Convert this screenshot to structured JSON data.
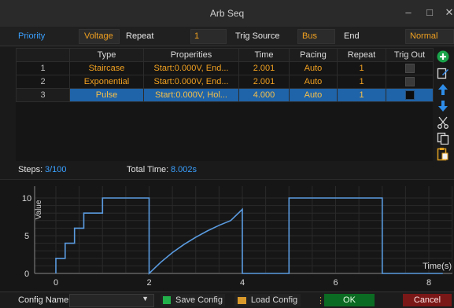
{
  "window": {
    "title": "Arb Seq"
  },
  "topbar": {
    "priority_label": "Priority",
    "priority_value": "Voltage",
    "repeat_label": "Repeat",
    "repeat_value": "1",
    "trig_source_label": "Trig Source",
    "trig_source_value": "Bus",
    "end_label": "End",
    "end_value": "Normal"
  },
  "table": {
    "columns": [
      "Type",
      "Properities",
      "Time",
      "Pacing",
      "Repeat",
      "Trig Out"
    ],
    "rows": [
      {
        "index": "1",
        "type": "Staircase",
        "properties": "Start:0.000V, End...",
        "time": "2.001",
        "pacing": "Auto",
        "repeat": "1",
        "trig_out": false,
        "selected": false
      },
      {
        "index": "2",
        "type": "Exponential",
        "properties": "Start:0.000V, End...",
        "time": "2.001",
        "pacing": "Auto",
        "repeat": "1",
        "trig_out": false,
        "selected": false
      },
      {
        "index": "3",
        "type": "Pulse",
        "properties": "Start:0.000V, Hol...",
        "time": "4.000",
        "pacing": "Auto",
        "repeat": "1",
        "trig_out": false,
        "selected": true
      }
    ]
  },
  "side_tools": [
    "add-icon",
    "edit-icon",
    "move-up-icon",
    "move-down-icon",
    "cut-icon",
    "copy-icon",
    "paste-icon"
  ],
  "info": {
    "steps_label": "Steps:",
    "steps_value": "3/100",
    "total_time_label": "Total Time:",
    "total_time_value": "8.002s"
  },
  "chart_data": {
    "type": "line",
    "ylabel": "Value",
    "xlabel": "Time(s)",
    "ylim": [
      0,
      10
    ],
    "xlim": [
      -1,
      8.3
    ],
    "yticks": [
      0,
      5,
      10
    ],
    "xticks": [
      0,
      2,
      4,
      6,
      8
    ],
    "grid": true,
    "color": "#5a9be0",
    "series": [
      {
        "points": [
          [
            0,
            0
          ],
          [
            0,
            2
          ],
          [
            0.2,
            2
          ],
          [
            0.2,
            4
          ],
          [
            0.4,
            4
          ],
          [
            0.4,
            6
          ],
          [
            0.6,
            6
          ],
          [
            0.6,
            8
          ],
          [
            1,
            8
          ],
          [
            1,
            10
          ],
          [
            2,
            10
          ],
          [
            2,
            0
          ],
          [
            2.25,
            1.48
          ],
          [
            2.5,
            2.76
          ],
          [
            2.75,
            3.84
          ],
          [
            3,
            4.8
          ],
          [
            3.25,
            5.64
          ],
          [
            3.5,
            6.38
          ],
          [
            3.75,
            7.01
          ],
          [
            4,
            8.5
          ],
          [
            4,
            0
          ],
          [
            5,
            0
          ],
          [
            5,
            10
          ],
          [
            6,
            10
          ],
          [
            6,
            10
          ],
          [
            7,
            10
          ],
          [
            7,
            0
          ],
          [
            8.3,
            0
          ]
        ]
      }
    ]
  },
  "bottombar": {
    "config_name_label": "Config Name",
    "config_name_value": "",
    "save_config": "Save Config",
    "load_config": "Load Config",
    "ok": "OK",
    "cancel": "Cancel"
  },
  "colors": {
    "accent_orange": "#f0a020",
    "accent_blue": "#3aa0ff",
    "selection": "#1f63a8",
    "ok_green": "#0c6b22",
    "cancel_red": "#7a1717"
  }
}
